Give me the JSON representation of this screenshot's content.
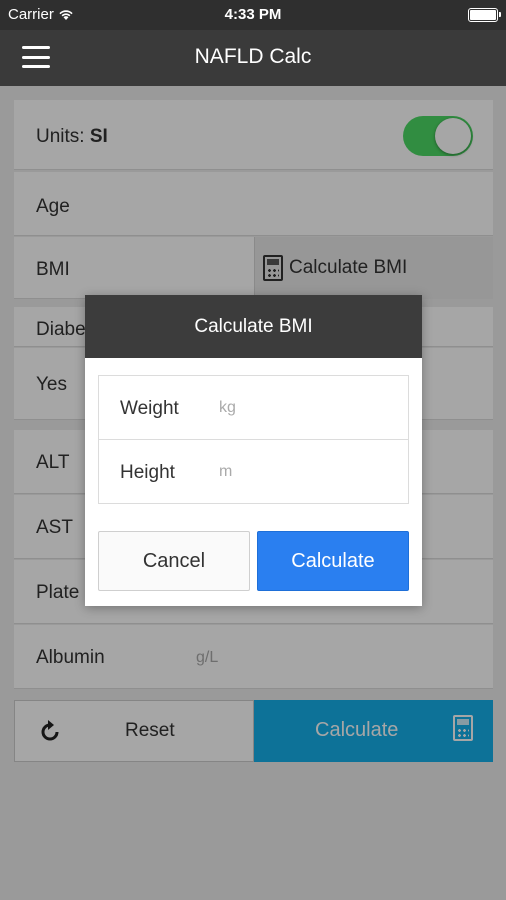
{
  "status_bar": {
    "carrier": "Carrier",
    "time": "4:33 PM"
  },
  "nav": {
    "title": "NAFLD Calc"
  },
  "form": {
    "units_label": "Units:",
    "units_value": "SI",
    "age_label": "Age",
    "bmi_label": "BMI",
    "calc_bmi_label": "Calculate BMI",
    "diabetes_label": "Diabe",
    "diabetes_value": "Yes",
    "alt_label": "ALT",
    "ast_label": "AST",
    "platelets_label": "Plate",
    "albumin_label": "Albumin",
    "albumin_unit": "g/L",
    "reset_label": "Reset",
    "calculate_label": "Calculate"
  },
  "modal": {
    "title": "Calculate BMI",
    "weight_label": "Weight",
    "weight_placeholder": "kg",
    "height_label": "Height",
    "height_placeholder": "m",
    "cancel_label": "Cancel",
    "calculate_label": "Calculate"
  },
  "colors": {
    "toggle_on": "#4cd964",
    "calculate_main": "#15b0ea",
    "modal_calculate": "#2a7ff0",
    "header": "#3a3a3a"
  },
  "icons": {
    "menu": "hamburger-icon",
    "wifi": "wifi-icon",
    "battery": "battery-icon",
    "calculator": "calculator-icon",
    "reset": "refresh-icon"
  }
}
